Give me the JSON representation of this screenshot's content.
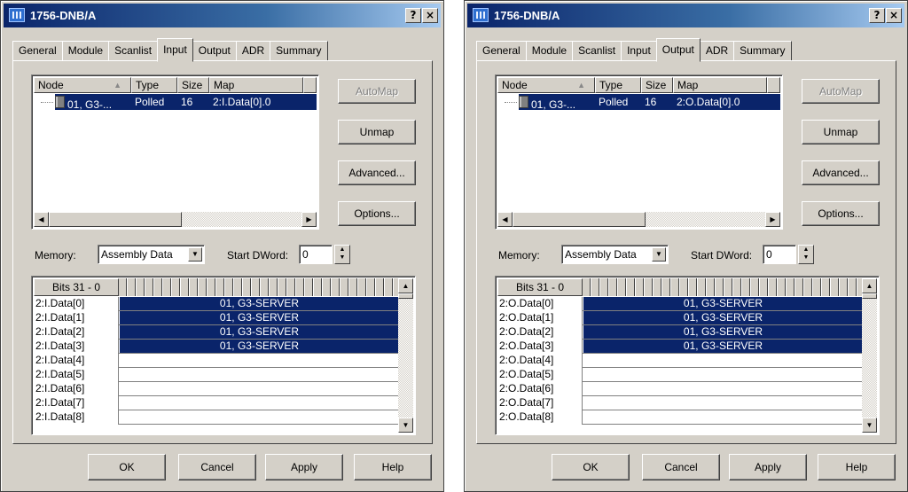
{
  "dialogs": [
    {
      "title": "1756-DNB/A",
      "help_button": "?",
      "close_button": "×",
      "tabs": [
        "General",
        "Module",
        "Scanlist",
        "Input",
        "Output",
        "ADR",
        "Summary"
      ],
      "active_tab": "Input",
      "scanlist": {
        "columns": [
          "Node",
          "Type",
          "Size",
          "Map"
        ],
        "rows": [
          {
            "node": "01, G3-...",
            "type": "Polled",
            "size": "16",
            "map": "2:I.Data[0].0"
          }
        ]
      },
      "buttons": {
        "automap": "AutoMap",
        "unmap": "Unmap",
        "advanced": "Advanced...",
        "options": "Options..."
      },
      "memory": {
        "label": "Memory:",
        "value": "Assembly Data"
      },
      "start_dword": {
        "label": "Start DWord:",
        "value": "0"
      },
      "bits_label": "Bits 31 - 0",
      "map_rows": [
        {
          "label": "2:I.Data[0]",
          "value": "01, G3-SERVER",
          "selected": true
        },
        {
          "label": "2:I.Data[1]",
          "value": "01, G3-SERVER",
          "selected": true
        },
        {
          "label": "2:I.Data[2]",
          "value": "01, G3-SERVER",
          "selected": true
        },
        {
          "label": "2:I.Data[3]",
          "value": "01, G3-SERVER",
          "selected": true
        },
        {
          "label": "2:I.Data[4]",
          "value": "",
          "selected": false
        },
        {
          "label": "2:I.Data[5]",
          "value": "",
          "selected": false
        },
        {
          "label": "2:I.Data[6]",
          "value": "",
          "selected": false
        },
        {
          "label": "2:I.Data[7]",
          "value": "",
          "selected": false
        },
        {
          "label": "2:I.Data[8]",
          "value": "",
          "selected": false
        }
      ],
      "footer": {
        "ok": "OK",
        "cancel": "Cancel",
        "apply": "Apply",
        "help": "Help"
      }
    },
    {
      "title": "1756-DNB/A",
      "help_button": "?",
      "close_button": "×",
      "tabs": [
        "General",
        "Module",
        "Scanlist",
        "Input",
        "Output",
        "ADR",
        "Summary"
      ],
      "active_tab": "Output",
      "scanlist": {
        "columns": [
          "Node",
          "Type",
          "Size",
          "Map"
        ],
        "rows": [
          {
            "node": "01, G3-...",
            "type": "Polled",
            "size": "16",
            "map": "2:O.Data[0].0"
          }
        ]
      },
      "buttons": {
        "automap": "AutoMap",
        "unmap": "Unmap",
        "advanced": "Advanced...",
        "options": "Options..."
      },
      "memory": {
        "label": "Memory:",
        "value": "Assembly Data"
      },
      "start_dword": {
        "label": "Start DWord:",
        "value": "0"
      },
      "bits_label": "Bits 31 - 0",
      "map_rows": [
        {
          "label": "2:O.Data[0]",
          "value": "01, G3-SERVER",
          "selected": true
        },
        {
          "label": "2:O.Data[1]",
          "value": "01, G3-SERVER",
          "selected": true
        },
        {
          "label": "2:O.Data[2]",
          "value": "01, G3-SERVER",
          "selected": true
        },
        {
          "label": "2:O.Data[3]",
          "value": "01, G3-SERVER",
          "selected": true
        },
        {
          "label": "2:O.Data[4]",
          "value": "",
          "selected": false
        },
        {
          "label": "2:O.Data[5]",
          "value": "",
          "selected": false
        },
        {
          "label": "2:O.Data[6]",
          "value": "",
          "selected": false
        },
        {
          "label": "2:O.Data[7]",
          "value": "",
          "selected": false
        },
        {
          "label": "2:O.Data[8]",
          "value": "",
          "selected": false
        }
      ],
      "footer": {
        "ok": "OK",
        "cancel": "Cancel",
        "apply": "Apply",
        "help": "Help"
      }
    }
  ]
}
